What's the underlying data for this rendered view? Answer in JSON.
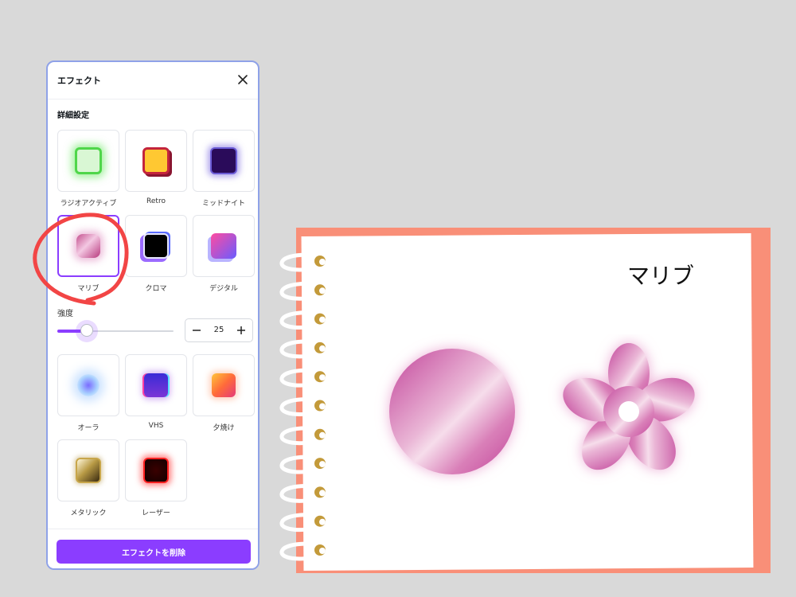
{
  "panel": {
    "title": "エフェクト",
    "section_title": "詳細設定",
    "effects_top": [
      {
        "label": "ラジオアクティブ",
        "icon": "radioactive-swatch"
      },
      {
        "label": "Retro",
        "icon": "retro-swatch"
      },
      {
        "label": "ミッドナイト",
        "icon": "midnight-swatch"
      },
      {
        "label": "マリブ",
        "icon": "malibu-swatch",
        "selected": true
      },
      {
        "label": "クロマ",
        "icon": "chroma-swatch"
      },
      {
        "label": "デジタル",
        "icon": "digital-swatch"
      }
    ],
    "intensity": {
      "label": "強度",
      "value": "25",
      "level": 0.25
    },
    "effects_bottom": [
      {
        "label": "オーラ",
        "icon": "aura-swatch"
      },
      {
        "label": "VHS",
        "icon": "vhs-swatch"
      },
      {
        "label": "夕焼け",
        "icon": "sunset-swatch"
      },
      {
        "label": "メタリック",
        "icon": "metallic-swatch"
      },
      {
        "label": "レーザー",
        "icon": "laser-swatch"
      }
    ],
    "remove_button": "エフェクトを削除"
  },
  "canvas": {
    "page_title": "マリブ"
  },
  "colors": {
    "accent": "#8b3dff",
    "panel_border": "#8fa2e8",
    "annotation": "#f24545",
    "notebook_cover": "#f98f78",
    "malibu_pink": "#d76fb0"
  }
}
